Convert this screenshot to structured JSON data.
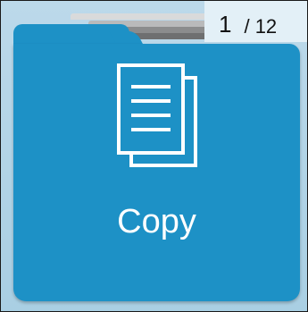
{
  "pager": {
    "current": "1",
    "separator": "/ 12"
  },
  "folder": {
    "label": "Copy",
    "icon": "document-copy-icon",
    "color": "#1d91c6"
  }
}
